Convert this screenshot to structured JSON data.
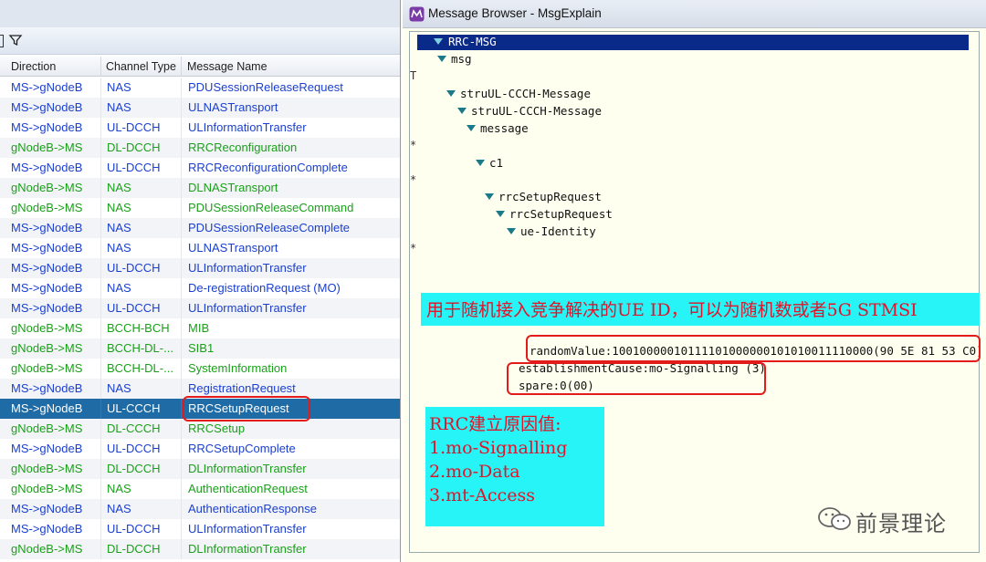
{
  "left": {
    "columns": [
      "Direction",
      "Channel Type",
      "Message Name"
    ],
    "rows": [
      {
        "direction": "MS->gNodeB",
        "channel": "NAS",
        "message": "PDUSessionReleaseRequest",
        "color": "#1a3fd0"
      },
      {
        "direction": "MS->gNodeB",
        "channel": "NAS",
        "message": "ULNASTransport",
        "color": "#1a3fd0"
      },
      {
        "direction": "MS->gNodeB",
        "channel": "UL-DCCH",
        "message": "ULInformationTransfer",
        "color": "#1a3fd0"
      },
      {
        "direction": "gNodeB->MS",
        "channel": "DL-DCCH",
        "message": "RRCReconfiguration",
        "color": "#1aa01a"
      },
      {
        "direction": "MS->gNodeB",
        "channel": "UL-DCCH",
        "message": "RRCReconfigurationComplete",
        "color": "#1a3fd0"
      },
      {
        "direction": "gNodeB->MS",
        "channel": "NAS",
        "message": "DLNASTransport",
        "color": "#1aa01a"
      },
      {
        "direction": "gNodeB->MS",
        "channel": "NAS",
        "message": "PDUSessionReleaseCommand",
        "color": "#1aa01a"
      },
      {
        "direction": "MS->gNodeB",
        "channel": "NAS",
        "message": "PDUSessionReleaseComplete",
        "color": "#1a3fd0"
      },
      {
        "direction": "MS->gNodeB",
        "channel": "NAS",
        "message": "ULNASTransport",
        "color": "#1a3fd0"
      },
      {
        "direction": "MS->gNodeB",
        "channel": "UL-DCCH",
        "message": "ULInformationTransfer",
        "color": "#1a3fd0"
      },
      {
        "direction": "MS->gNodeB",
        "channel": "NAS",
        "message": "De-registrationRequest (MO)",
        "color": "#1a3fd0"
      },
      {
        "direction": "MS->gNodeB",
        "channel": "UL-DCCH",
        "message": "ULInformationTransfer",
        "color": "#1a3fd0"
      },
      {
        "direction": "gNodeB->MS",
        "channel": "BCCH-BCH",
        "message": "MIB",
        "color": "#1aa01a"
      },
      {
        "direction": "gNodeB->MS",
        "channel": "BCCH-DL-...",
        "message": "SIB1",
        "color": "#1aa01a"
      },
      {
        "direction": "gNodeB->MS",
        "channel": "BCCH-DL-...",
        "message": "SystemInformation",
        "color": "#1aa01a"
      },
      {
        "direction": "MS->gNodeB",
        "channel": "NAS",
        "message": "RegistrationRequest",
        "color": "#1a3fd0"
      },
      {
        "direction": "MS->gNodeB",
        "channel": "UL-CCCH",
        "message": "RRCSetupRequest",
        "color": "#ffffff",
        "selected": true
      },
      {
        "direction": "gNodeB->MS",
        "channel": "DL-CCCH",
        "message": "RRCSetup",
        "color": "#1aa01a"
      },
      {
        "direction": "MS->gNodeB",
        "channel": "UL-DCCH",
        "message": "RRCSetupComplete",
        "color": "#1a3fd0"
      },
      {
        "direction": "gNodeB->MS",
        "channel": "DL-DCCH",
        "message": "DLInformationTransfer",
        "color": "#1aa01a"
      },
      {
        "direction": "gNodeB->MS",
        "channel": "NAS",
        "message": "AuthenticationRequest",
        "color": "#1aa01a"
      },
      {
        "direction": "MS->gNodeB",
        "channel": "NAS",
        "message": "AuthenticationResponse",
        "color": "#1a3fd0"
      },
      {
        "direction": "MS->gNodeB",
        "channel": "UL-DCCH",
        "message": "ULInformationTransfer",
        "color": "#1a3fd0"
      },
      {
        "direction": "gNodeB->MS",
        "channel": "DL-DCCH",
        "message": "DLInformationTransfer",
        "color": "#1aa01a"
      }
    ]
  },
  "right": {
    "title": "Message Browser - MsgExplain",
    "tree": {
      "root": "RRC-MSG",
      "msg": "msg",
      "t_marker": "T",
      "star": "*",
      "n1": "struUL-CCCH-Message",
      "n2": "struUL-CCCH-Message",
      "n3": "message",
      "n4": "c1",
      "n5": "rrcSetupRequest",
      "n6": "rrcSetupRequest",
      "n7": "ue-Identity",
      "randomValue": "randomValue:10010000010111101000000101010011110000(90 5E 81 53 C0)",
      "establishmentCause": "establishmentCause:mo-Signalling (3)",
      "spare": "spare:0(00)"
    },
    "annotation1": "用于随机接入竞争解决的UE ID，可以为随机数或者5G STMSI",
    "annotation2": {
      "title": "RRC建立原因值:",
      "items": [
        "1.mo-Signalling",
        "2.mo-Data",
        "3.mt-Access"
      ]
    }
  },
  "watermark": "前景理论"
}
